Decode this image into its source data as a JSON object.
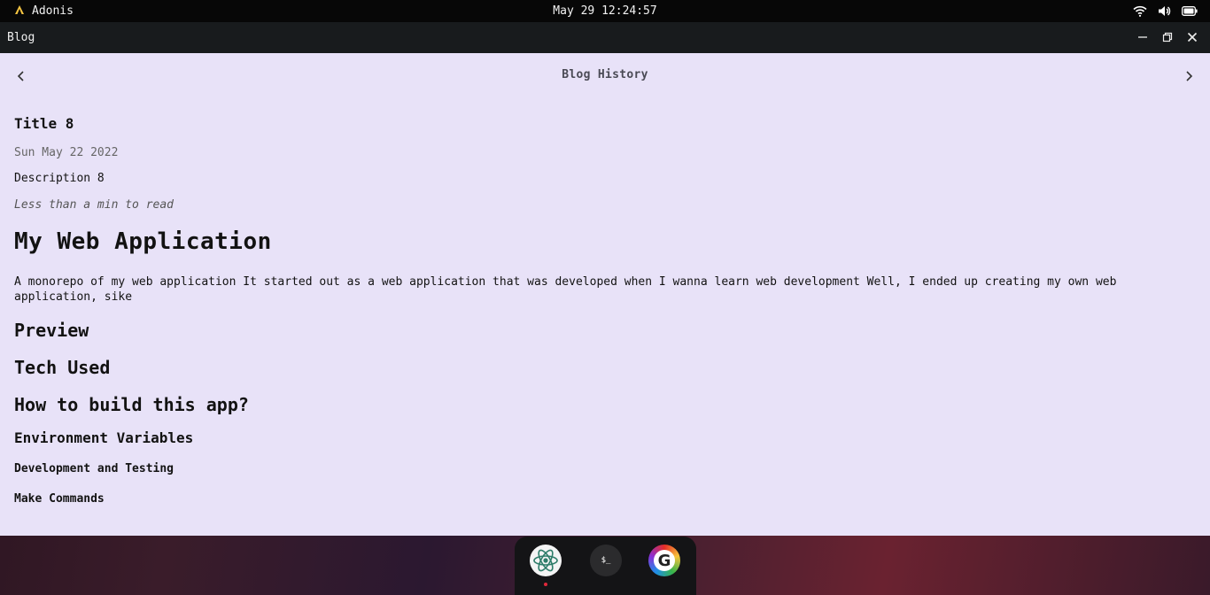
{
  "topbar": {
    "brand": "Adonis",
    "clock": "May 29 12:24:57"
  },
  "window": {
    "title": "Blog"
  },
  "nav": {
    "title": "Blog History"
  },
  "post": {
    "title": "Title 8",
    "date": "Sun May 22 2022",
    "description": "Description 8",
    "read_time": "Less than a min to read"
  },
  "article": {
    "heading": "My Web Application",
    "intro": "A monorepo of my web application It started out as a web application that was developed when I wanna learn web development Well, I ended up creating my own web application, sike",
    "section_preview": "Preview",
    "section_tech": "Tech Used",
    "section_build": "How to build this app?",
    "sub_env": "Environment Variables",
    "sub_dev": "Development and Testing",
    "sub_make": "Make Commands"
  },
  "dock": {
    "terminal_label": "$_",
    "google_label": "G"
  },
  "colors": {
    "window_bg": "#e8e2f8",
    "titlebar_bg": "#181b1d",
    "topbar_bg": "#070707",
    "running_indicator": "#e0283a"
  }
}
